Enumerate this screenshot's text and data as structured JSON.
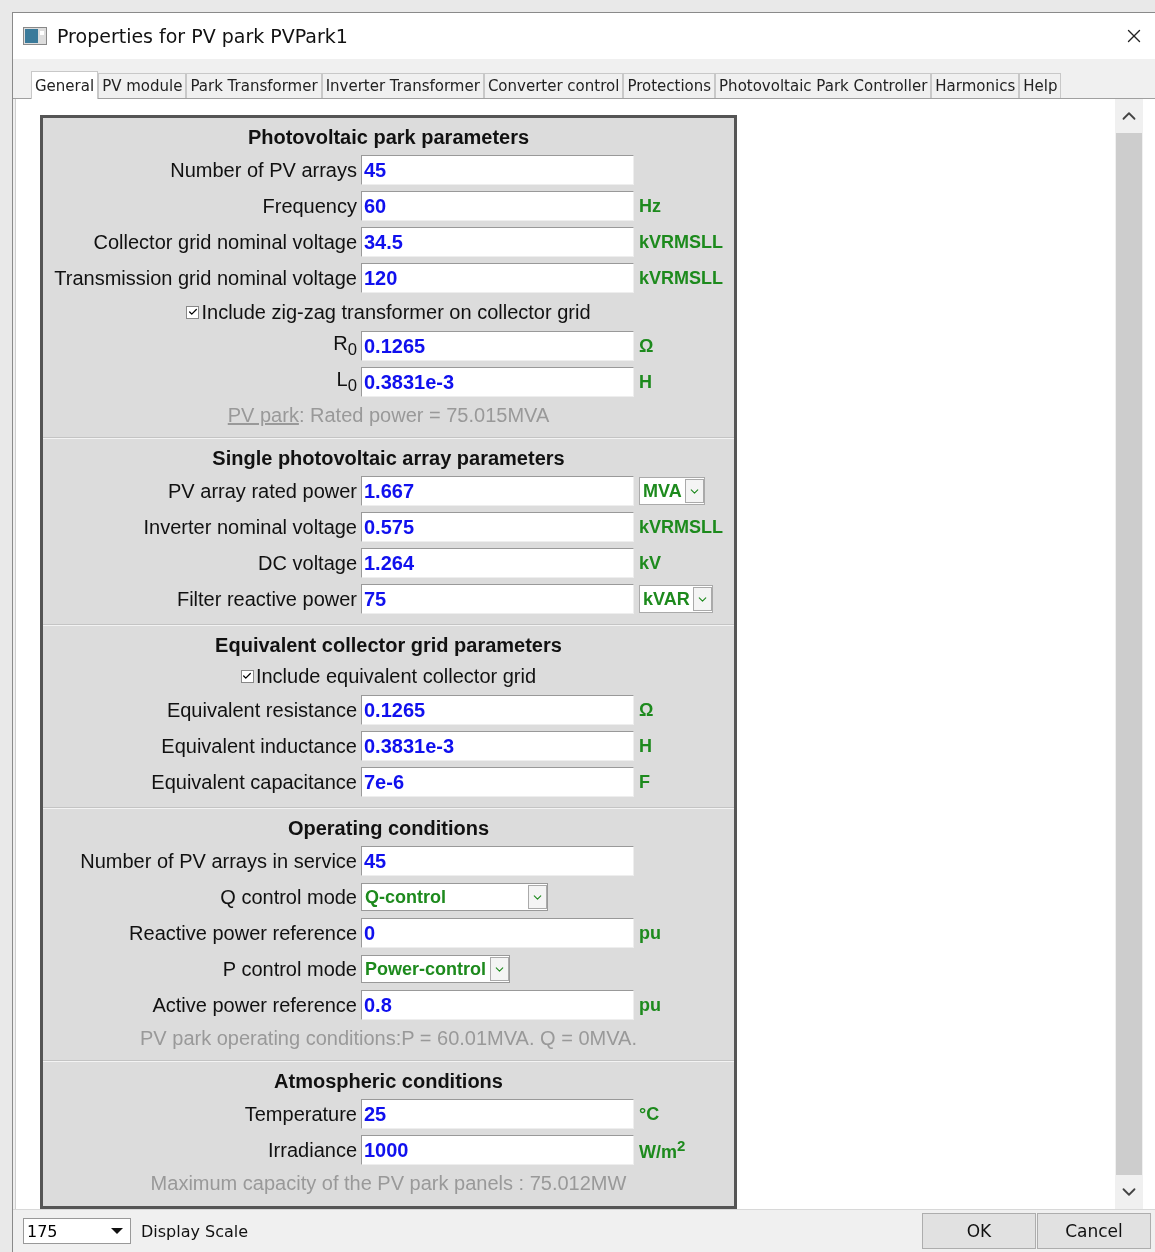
{
  "window": {
    "title": "Properties for PV park PVPark1"
  },
  "tabs": [
    {
      "label": "General",
      "selected": true
    },
    {
      "label": "PV module",
      "selected": false
    },
    {
      "label": "Park Transformer",
      "selected": false
    },
    {
      "label": "Inverter Transformer",
      "selected": false
    },
    {
      "label": "Converter control",
      "selected": false
    },
    {
      "label": "Protections",
      "selected": false
    },
    {
      "label": "Photovoltaic Park Controller",
      "selected": false
    },
    {
      "label": "Harmonics",
      "selected": false
    },
    {
      "label": "Help",
      "selected": false
    }
  ],
  "sections": [
    {
      "title": "Photovoltaic park parameters",
      "rows": [
        {
          "kind": "field",
          "label": "Number of PV arrays",
          "value": "45"
        },
        {
          "kind": "field",
          "label": "Frequency",
          "value": "60",
          "unit": {
            "kind": "text",
            "text": "Hz"
          }
        },
        {
          "kind": "field",
          "label": "Collector grid nominal voltage",
          "value": "34.5",
          "unit": {
            "kind": "text",
            "text": "kVRMSLL"
          }
        },
        {
          "kind": "field",
          "label": "Transmission grid nominal voltage",
          "value": "120",
          "unit": {
            "kind": "text",
            "text": "kVRMSLL"
          }
        },
        {
          "kind": "checkbox",
          "label": "Include zig-zag transformer on collector grid",
          "checked": true
        },
        {
          "kind": "field",
          "label": "R$_{0}$",
          "value": "0.1265",
          "unit": {
            "kind": "text",
            "text": "Ω"
          }
        },
        {
          "kind": "field",
          "label": "L$_{0}$",
          "value": "0.3831e-3",
          "unit": {
            "kind": "text",
            "text": "H"
          }
        },
        {
          "kind": "note",
          "link": "PV park",
          "text": ": Rated power = 75.015MVA"
        }
      ]
    },
    {
      "title": "Single photovoltaic array parameters",
      "rows": [
        {
          "kind": "field",
          "label": "PV array rated power",
          "value": "1.667",
          "unit": {
            "kind": "select",
            "text": "MVA"
          }
        },
        {
          "kind": "field",
          "label": "Inverter nominal voltage",
          "value": "0.575",
          "unit": {
            "kind": "text",
            "text": "kVRMSLL"
          }
        },
        {
          "kind": "field",
          "label": "DC voltage",
          "value": "1.264",
          "unit": {
            "kind": "text",
            "text": "kV"
          }
        },
        {
          "kind": "field",
          "label": "Filter reactive power",
          "value": "75",
          "unit": {
            "kind": "select",
            "text": "kVAR"
          }
        }
      ]
    },
    {
      "title": "Equivalent collector grid parameters",
      "rows": [
        {
          "kind": "checkbox",
          "label": "Include equivalent collector grid",
          "checked": true
        },
        {
          "kind": "field",
          "label": "Equivalent resistance",
          "value": "0.1265",
          "unit": {
            "kind": "text",
            "text": "Ω"
          }
        },
        {
          "kind": "field",
          "label": "Equivalent inductance",
          "value": "0.3831e-3",
          "unit": {
            "kind": "text",
            "text": "H"
          }
        },
        {
          "kind": "field",
          "label": "Equivalent capacitance",
          "value": "7e-6",
          "unit": {
            "kind": "text",
            "text": "F"
          }
        }
      ]
    },
    {
      "title": "Operating conditions",
      "rows": [
        {
          "kind": "field",
          "label": "Number of PV arrays in service",
          "value": "45"
        },
        {
          "kind": "select",
          "label": "Q control mode",
          "value": "Q-control"
        },
        {
          "kind": "field",
          "label": "Reactive power reference",
          "value": "0",
          "unit": {
            "kind": "text",
            "text": "pu"
          }
        },
        {
          "kind": "select",
          "label": "P control mode",
          "value": "Power-control"
        },
        {
          "kind": "field",
          "label": "Active power reference",
          "value": "0.8",
          "unit": {
            "kind": "text",
            "text": "pu"
          }
        },
        {
          "kind": "note",
          "text": "PV park operating conditions:P = 60.01MVA. Q = 0MVA."
        }
      ]
    },
    {
      "title": "Atmospheric conditions",
      "rows": [
        {
          "kind": "field",
          "label": "Temperature",
          "value": "25",
          "unit": {
            "kind": "text",
            "text": "°C"
          }
        },
        {
          "kind": "field",
          "label": "Irradiance",
          "value": "1000",
          "unit": {
            "kind": "text",
            "text": "W/m$^{2}$"
          }
        },
        {
          "kind": "note",
          "text": "Maximum capacity of the PV park panels : 75.012MW"
        }
      ]
    }
  ],
  "footer": {
    "scale": "175",
    "scale_label": "Display Scale",
    "buttons": [
      "OK",
      "Cancel"
    ]
  }
}
